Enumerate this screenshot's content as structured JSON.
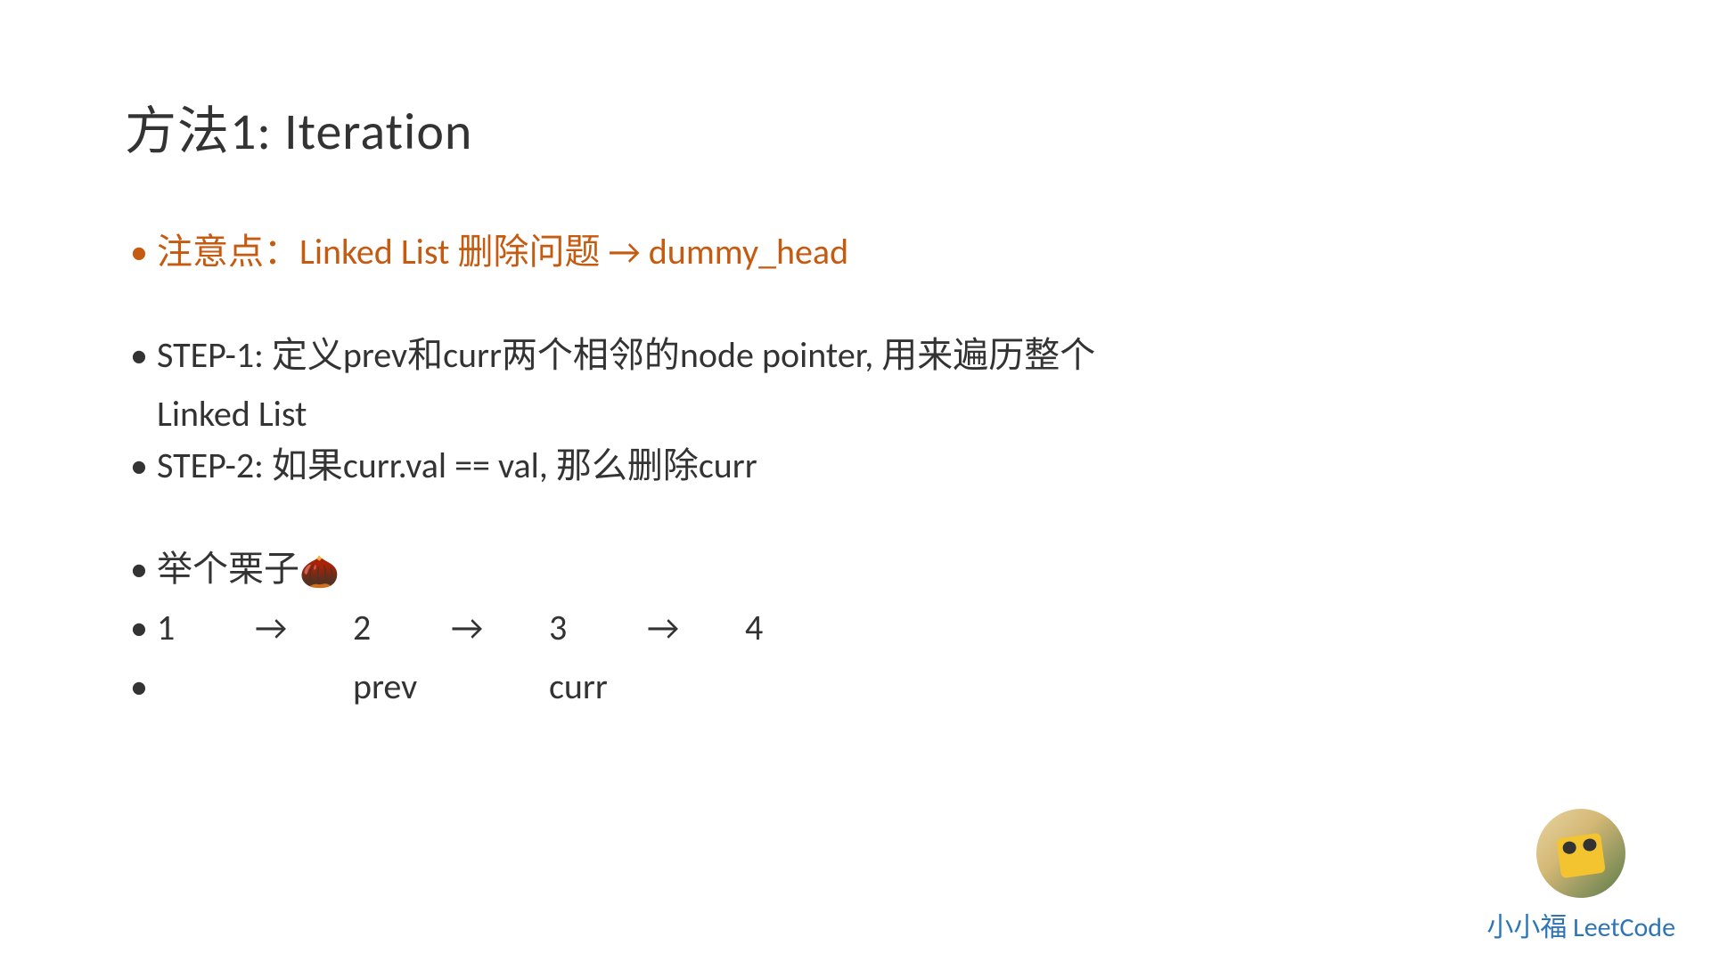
{
  "slide": {
    "title": "方法1: Iteration",
    "bullets": {
      "highlight": "注意点：Linked List 删除问题 → dummy_head",
      "step1_line1": "STEP-1: 定义prev和curr两个相邻的node pointer, 用来遍历整个",
      "step1_line2": "Linked List",
      "step2": "STEP-2: 如果curr.val == val, 那么删除curr",
      "example_label": "举个栗子",
      "chestnut_emoji": "🌰"
    },
    "linked_list": {
      "n1": "1",
      "a1": "→",
      "n2": "2",
      "a2": "→",
      "n3": "3",
      "a3": "→",
      "n4": "4",
      "prev_label": "prev",
      "curr_label": "curr"
    }
  },
  "footer": {
    "author": "小小福 LeetCode"
  }
}
